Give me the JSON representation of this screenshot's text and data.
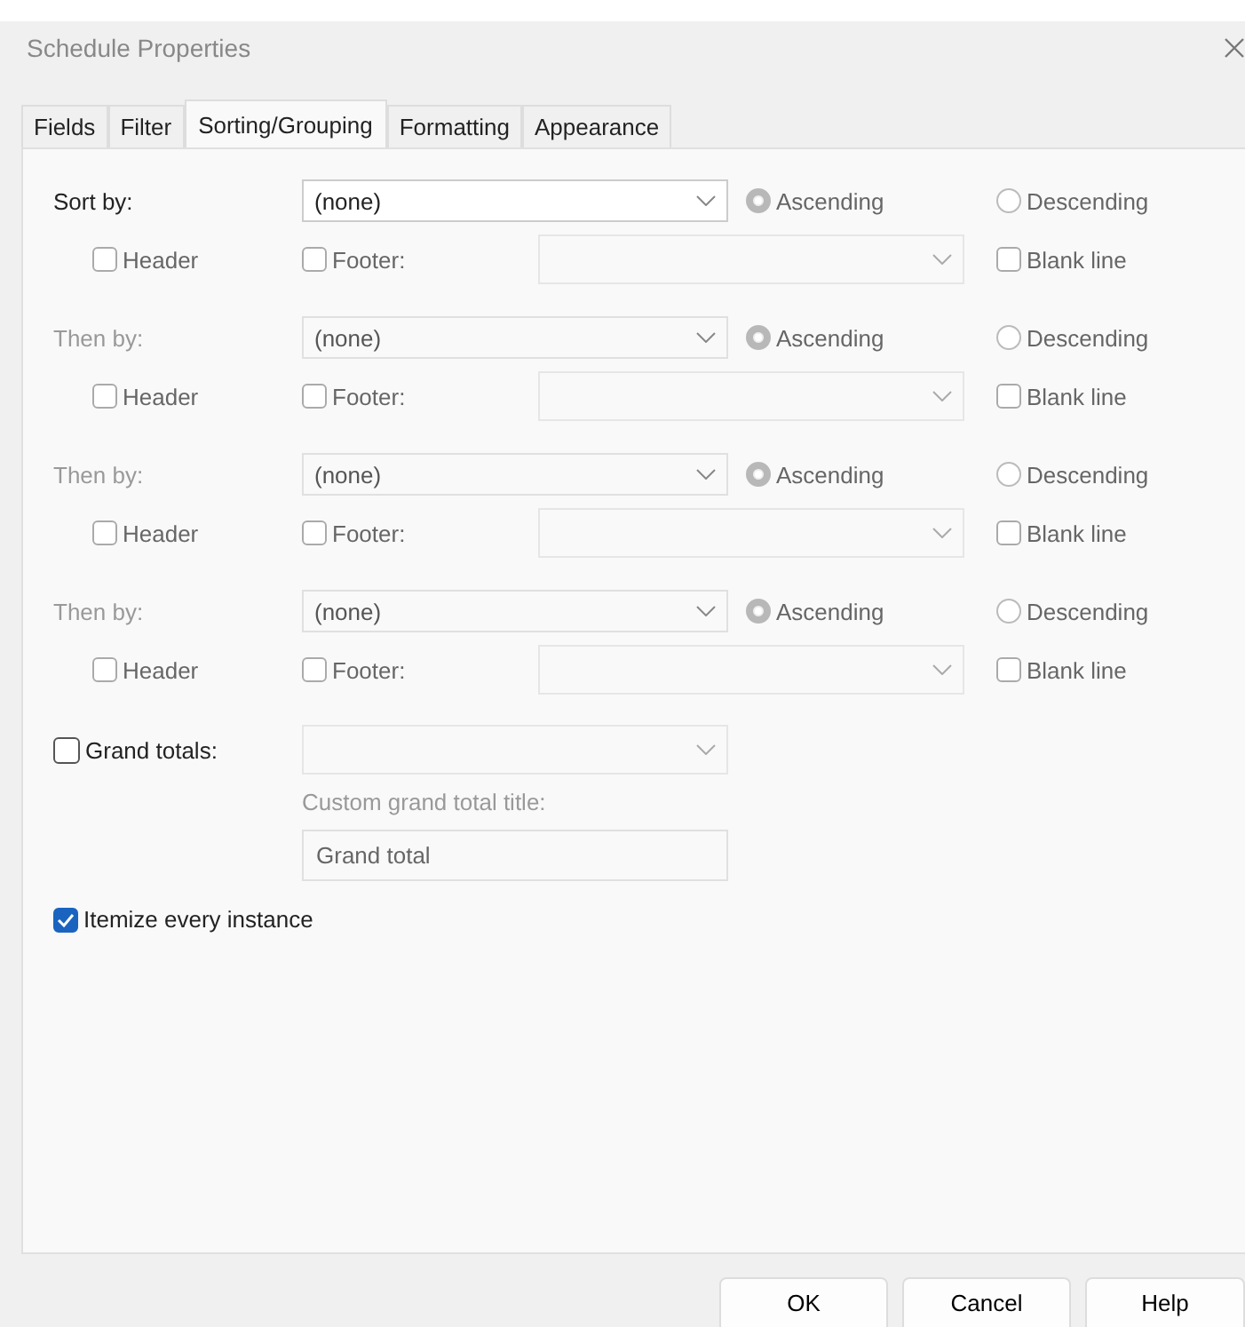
{
  "window": {
    "title": "Schedule Properties"
  },
  "tabs": [
    {
      "label": "Fields",
      "selected": false
    },
    {
      "label": "Filter",
      "selected": false
    },
    {
      "label": "Sorting/Grouping",
      "selected": true
    },
    {
      "label": "Formatting",
      "selected": false
    },
    {
      "label": "Appearance",
      "selected": false
    }
  ],
  "sort_levels": [
    {
      "label": "Sort by:",
      "disabled": false,
      "field": "(none)",
      "orders": [
        {
          "label": "Ascending",
          "selected": true
        },
        {
          "label": "Descending",
          "selected": false
        }
      ],
      "header_label": "Header",
      "header": false,
      "footer_label": "Footer:",
      "footer": false,
      "blank_line_label": "Blank line",
      "blank_line": false
    },
    {
      "label": "Then by:",
      "disabled": true,
      "field": "(none)",
      "orders": [
        {
          "label": "Ascending",
          "selected": true
        },
        {
          "label": "Descending",
          "selected": false
        }
      ],
      "header_label": "Header",
      "header": false,
      "footer_label": "Footer:",
      "footer": false,
      "blank_line_label": "Blank line",
      "blank_line": false
    },
    {
      "label": "Then by:",
      "disabled": true,
      "field": "(none)",
      "orders": [
        {
          "label": "Ascending",
          "selected": true
        },
        {
          "label": "Descending",
          "selected": false
        }
      ],
      "header_label": "Header",
      "header": false,
      "footer_label": "Footer:",
      "footer": false,
      "blank_line_label": "Blank line",
      "blank_line": false
    },
    {
      "label": "Then by:",
      "disabled": true,
      "field": "(none)",
      "orders": [
        {
          "label": "Ascending",
          "selected": true
        },
        {
          "label": "Descending",
          "selected": false
        }
      ],
      "header_label": "Header",
      "header": false,
      "footer_label": "Footer:",
      "footer": false,
      "blank_line_label": "Blank line",
      "blank_line": false
    }
  ],
  "grand_totals": {
    "label": "Grand totals:",
    "checked": false,
    "custom_title_label": "Custom grand total title:",
    "custom_title_value": "Grand total"
  },
  "itemize": {
    "label": "Itemize every instance",
    "checked": true
  },
  "buttons": [
    "OK",
    "Cancel",
    "Help"
  ]
}
